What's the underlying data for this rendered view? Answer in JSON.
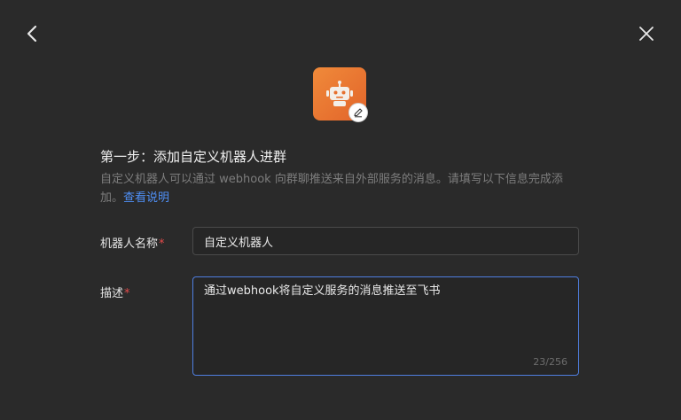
{
  "header": {
    "back_icon": "chevron-left-icon",
    "close_icon": "close-icon"
  },
  "avatar": {
    "icon": "robot-icon",
    "edit_icon": "pencil-icon",
    "color_start": "#f08a3a",
    "color_end": "#e2642a"
  },
  "step": {
    "title": "第一步：添加自定义机器人进群",
    "description": "自定义机器人可以通过 webhook 向群聊推送来自外部服务的消息。请填写以下信息完成添加。",
    "link_text": "查看说明"
  },
  "form": {
    "name": {
      "label": "机器人名称",
      "required_mark": "*",
      "value": "自定义机器人"
    },
    "description": {
      "label": "描述",
      "required_mark": "*",
      "value": "通过webhook将自定义服务的消息推送至飞书",
      "counter": "23/256"
    }
  },
  "colors": {
    "background": "#2a2a2a",
    "accent": "#4f8ff5",
    "required": "#e24a4a",
    "focus_border": "#4f7ee0"
  }
}
